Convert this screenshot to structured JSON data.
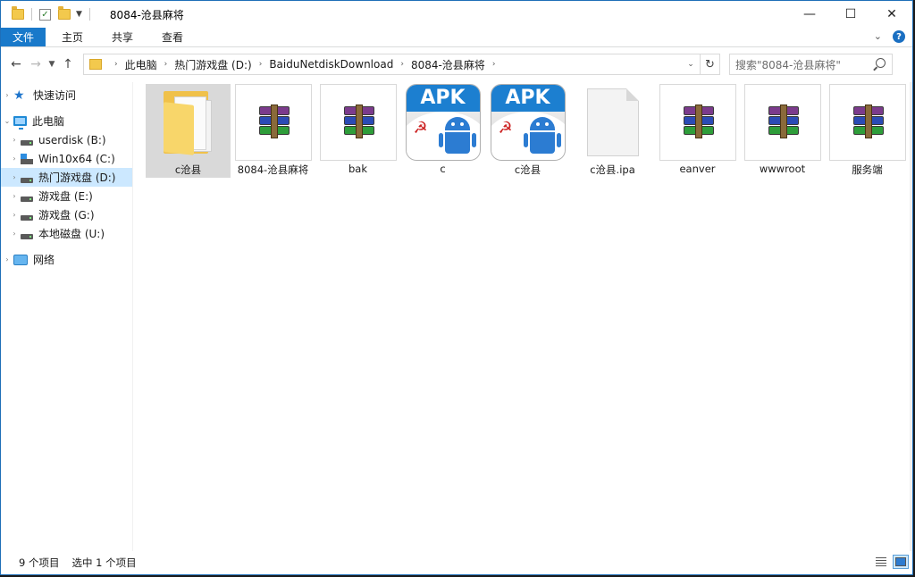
{
  "window": {
    "title": "8084-沧县麻将",
    "controls": {
      "minimize": "—",
      "maximize": "☐",
      "close": "✕"
    }
  },
  "ribbon": {
    "file_tab": "文件",
    "tabs": [
      "主页",
      "共享",
      "查看"
    ]
  },
  "address": {
    "crumbs": [
      "此电脑",
      "热门游戏盘 (D:)",
      "BaiduNetdiskDownload",
      "8084-沧县麻将"
    ]
  },
  "search": {
    "placeholder": "搜索\"8084-沧县麻将\""
  },
  "sidebar": {
    "items": [
      {
        "label": "快速访问",
        "icon": "star-icon"
      },
      {
        "label": "此电脑",
        "icon": "computer-icon"
      },
      {
        "label": "userdisk (B:)",
        "icon": "drive-icon"
      },
      {
        "label": "Win10x64 (C:)",
        "icon": "windows-drive-icon"
      },
      {
        "label": "热门游戏盘 (D:)",
        "icon": "drive-icon",
        "selected": true
      },
      {
        "label": "游戏盘 (E:)",
        "icon": "drive-icon"
      },
      {
        "label": "游戏盘 (G:)",
        "icon": "drive-icon"
      },
      {
        "label": "本地磁盘 (U:)",
        "icon": "drive-icon"
      },
      {
        "label": "网络",
        "icon": "network-icon"
      }
    ]
  },
  "files": [
    {
      "name": "c沧县",
      "type": "folder",
      "selected": true
    },
    {
      "name": "8084-沧县麻将",
      "type": "rar"
    },
    {
      "name": "bak",
      "type": "rar"
    },
    {
      "name": "c",
      "type": "apk"
    },
    {
      "name": "c沧县",
      "type": "apk"
    },
    {
      "name": "c沧县.ipa",
      "type": "blank"
    },
    {
      "name": "eanver",
      "type": "rar"
    },
    {
      "name": "wwwroot",
      "type": "rar"
    },
    {
      "name": "服务端",
      "type": "rar"
    }
  ],
  "apk_label": "APK",
  "status": {
    "count": "9 个项目",
    "selected": "选中 1 个项目"
  }
}
